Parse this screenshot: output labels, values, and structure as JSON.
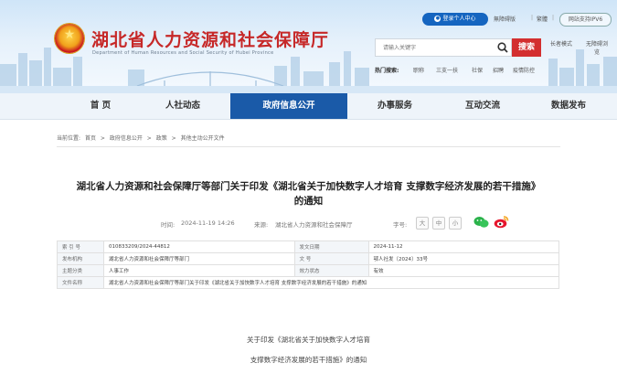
{
  "header": {
    "site_title": "湖北省人力资源和社会保障厅",
    "site_subtitle": "Department of Human Resources and Social Security of Hubei Province",
    "login_label": "登录个人中心",
    "top_links": [
      "無障碍版",
      "繁體",
      "网站支持IPV6"
    ],
    "search_placeholder": "请输入关键字",
    "search_button": "搜索",
    "mode_links": [
      "长者模式",
      "无障碍浏览"
    ],
    "hot_label": "热门搜索:",
    "hot_items": [
      "职称",
      "三支一扶",
      "社保",
      "招聘",
      "疫情防控"
    ]
  },
  "nav": {
    "items": [
      "首 页",
      "人社动态",
      "政府信息公开",
      "办事服务",
      "互动交流",
      "数据发布"
    ],
    "active_index": 2
  },
  "breadcrumb": {
    "label": "当前位置:",
    "items": [
      "首页",
      "政府信息公开",
      "政策",
      "其他主动公开文件"
    ],
    "separator": ">"
  },
  "article": {
    "title_line1": "湖北省人力资源和社会保障厅等部门关于印发《湖北省关于加快数字人才培育 支撑数字经济发展的若干措施》",
    "title_line2": "的通知",
    "time_label": "时间:",
    "time_value": "2024-11-19 14:26",
    "source_label": "来源:",
    "source_value": "湖北省人力资源和社会保障厅",
    "font_size_label": "字号:",
    "font_size_options": [
      "大",
      "中",
      "小"
    ]
  },
  "info_table": {
    "rows": [
      {
        "k1": "索 引 号",
        "v1": "010833209/2024-44812",
        "k2": "发文日期",
        "v2": "2024-11-12"
      },
      {
        "k1": "发布机构",
        "v1": "湖北省人力资源和社会保障厅等部门",
        "k2": "文    号",
        "v2": "鄂人社发〔2024〕33号"
      },
      {
        "k1": "主题分类",
        "v1": "人事工作",
        "k2": "效力状态",
        "v2": "有效"
      }
    ],
    "name_label": "文件名称",
    "name_value": "湖北省人力资源和社会保障厅等部门关于印发《湖北省关于加快数字人才培育 支撑数字经济发展的若干措施》的通知"
  },
  "body": {
    "line1": "关于印发《湖北省关于加快数字人才培育",
    "line2": "支撑数字经济发展的若干措施》的通知"
  },
  "colors": {
    "brand_red": "#c62828",
    "nav_active": "#1a5aa8",
    "login_blue": "#1565c0",
    "search_red": "#d32f2f"
  }
}
